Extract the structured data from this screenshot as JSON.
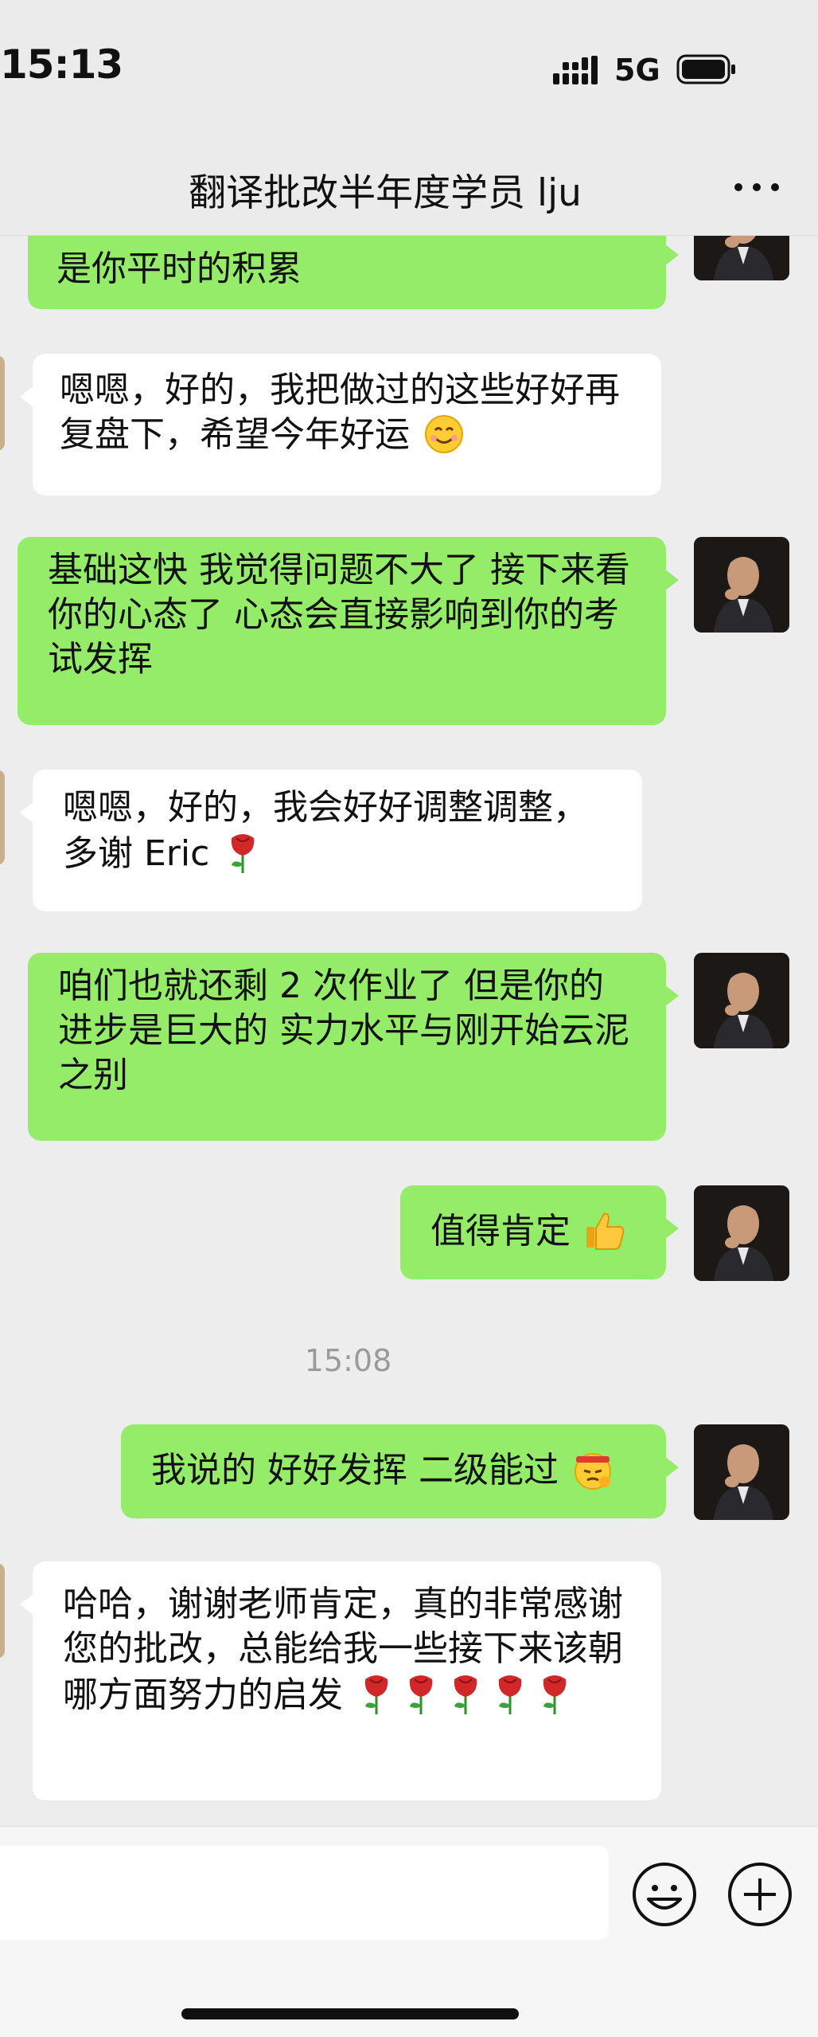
{
  "status_bar": {
    "time": "15:13",
    "network": "5G"
  },
  "header": {
    "title": "翻译批改半年度学员 lju"
  },
  "messages": [
    {
      "side": "sent",
      "text": "是你平时的积累",
      "emoji": ""
    },
    {
      "side": "recv",
      "text": "嗯嗯，好的，我把做过的这些好好再复盘下，希望今年好运",
      "emoji": "smiling-face-emoji"
    },
    {
      "side": "sent",
      "text": "基础这快 我觉得问题不大了 接下来看你的心态了 心态会直接影响到你的考试发挥",
      "emoji": ""
    },
    {
      "side": "recv",
      "text": "嗯嗯，好的，我会好好调整调整，多谢 Eric",
      "emoji": "rose-emoji"
    },
    {
      "side": "sent",
      "text": "咱们也就还剩 2 次作业了 但是你的进步是巨大的 实力水平与刚开始云泥之别",
      "emoji": ""
    },
    {
      "side": "sent",
      "text": "值得肯定",
      "emoji": "thumbs-up-emoji"
    },
    {
      "side": "sent",
      "text": "我说的 好好发挥 二级能过",
      "emoji": "determined-face-emoji"
    },
    {
      "side": "recv",
      "text": "哈哈，谢谢老师肯定，真的非常感谢您的批改，总能给我一些接下来该朝哪方面努力的启发",
      "emoji": "rose-emoji x5"
    }
  ],
  "timestamp": "15:08",
  "colors": {
    "sent_bubble": "#95ec69",
    "recv_bubble": "#ffffff",
    "background": "#ededed"
  }
}
